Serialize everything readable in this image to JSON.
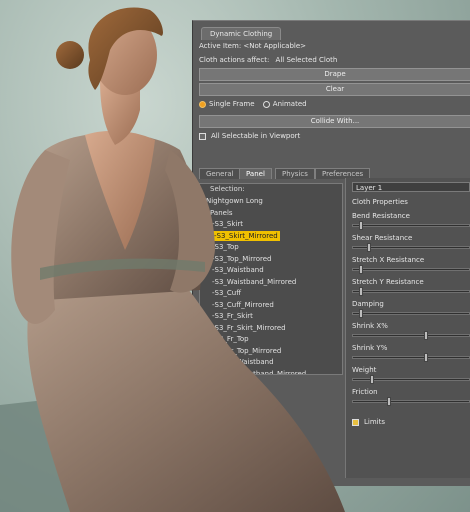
{
  "panel": {
    "title": "Dynamic Clothing",
    "active_item": "Active Item: <Not Applicable>",
    "cloth_actions_label": "Cloth actions affect:",
    "cloth_actions_value": "All Selected Cloth",
    "drape": "Drape",
    "clear": "Clear",
    "single_frame": "Single Frame",
    "animated": "Animated",
    "collide_with": "Collide With...",
    "all_selectable": "All Selectable in Viewport",
    "tabs": [
      "General",
      "Panel",
      "Physics",
      "Preferences"
    ],
    "selection_label": "Selection:",
    "tree": [
      "Nightgown Long",
      "Panels",
      "-S3_Skirt",
      "-S3_Skirt_Mirrored",
      "-S3_Top",
      "-S3_Top_Mirrored",
      "-S3_Waistband",
      "-S3_Waistband_Mirrored",
      "-S3_Cuff",
      "-S3_Cuff_Mirrored",
      "-S3_Fr_Skirt",
      "-S3_Fr_Skirt_Mirrored",
      "-S3_Fr_Top",
      "-S3_Fr_Top_Mirrored",
      "-S3_Fr_Waistband",
      "-S3_Fr_Waistband_Mirrored"
    ],
    "selected_index": 3,
    "layer": "Layer 1",
    "cloth_properties": "Cloth Properties",
    "properties": [
      {
        "label": "Bend Resistance",
        "value": 0.05
      },
      {
        "label": "Shear Resistance",
        "value": 0.12
      },
      {
        "label": "Stretch X Resistance",
        "value": 0.05
      },
      {
        "label": "Stretch Y Resistance",
        "value": 0.05
      },
      {
        "label": "Damping",
        "value": 0.05
      },
      {
        "label": "Shrink X%",
        "value": 0.62
      },
      {
        "label": "Shrink Y%",
        "value": 0.62
      },
      {
        "label": "Weight",
        "value": 0.15
      },
      {
        "label": "Friction",
        "value": 0.3
      }
    ],
    "limits": "Limits"
  }
}
